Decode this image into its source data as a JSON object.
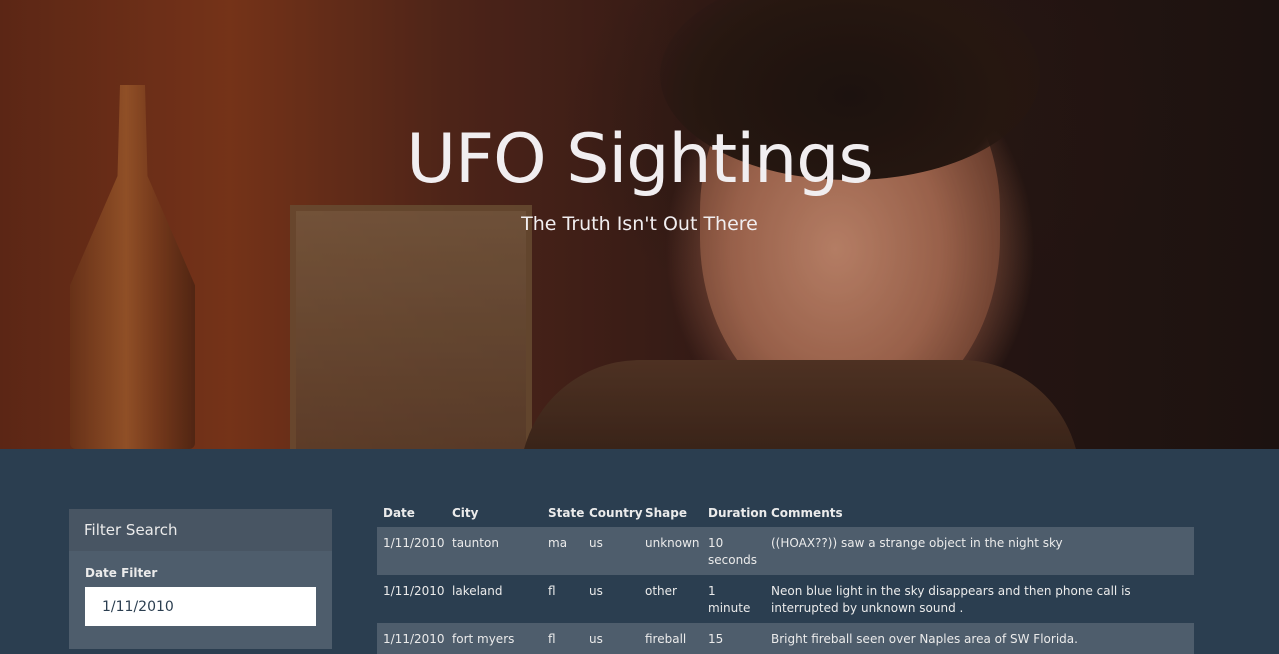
{
  "hero": {
    "title": "UFO Sightings",
    "subtitle": "The Truth Isn't Out There"
  },
  "filter": {
    "header": "Filter Search",
    "date_label": "Date Filter",
    "date_value": "1/11/2010"
  },
  "table": {
    "columns": [
      "Date",
      "City",
      "State",
      "Country",
      "Shape",
      "Duration",
      "Comments"
    ],
    "rows": [
      [
        "1/11/2010",
        "taunton",
        "ma",
        "us",
        "unknown",
        "10 seconds",
        "((HOAX??)) saw a strange object in the night sky"
      ],
      [
        "1/11/2010",
        "lakeland",
        "fl",
        "us",
        "other",
        "1 minute",
        "Neon blue light in the sky disappears and then phone call is interrupted by unknown sound ."
      ],
      [
        "1/11/2010",
        "fort myers",
        "fl",
        "us",
        "fireball",
        "15",
        "Bright fireball seen over Naples area of SW Florida."
      ]
    ]
  },
  "colors": {
    "page_bg": "#2b3e50",
    "panel_bg": "#4e5d6c",
    "text": "#ebebeb"
  }
}
